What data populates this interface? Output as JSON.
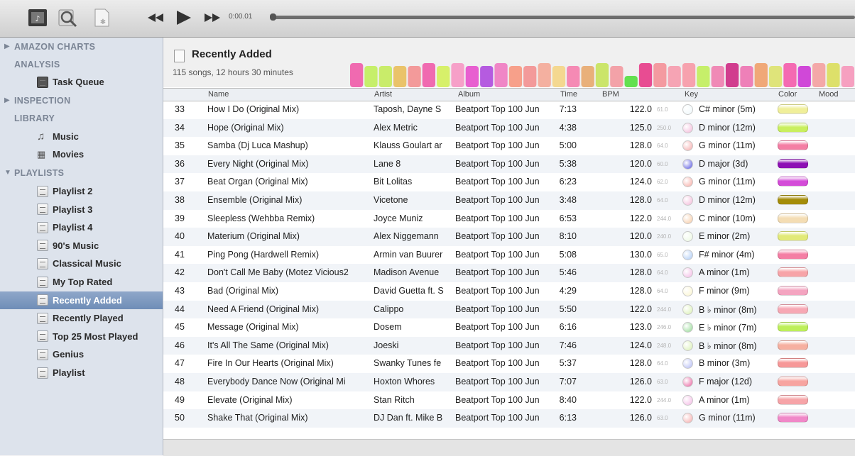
{
  "player": {
    "time": "0:00.01",
    "progress": 0.0
  },
  "sidebar": {
    "sections": [
      {
        "label": "AMAZON CHARTS",
        "collapsed": true
      },
      {
        "label": "ANALYSIS",
        "collapsed": null
      },
      {
        "label": "INSPECTION",
        "collapsed": true
      },
      {
        "label": "LIBRARY",
        "collapsed": null
      },
      {
        "label": "PLAYLISTS",
        "collapsed": false
      }
    ],
    "analysis_items": [
      "Task Queue"
    ],
    "library_items": [
      "Music",
      "Movies"
    ],
    "playlist_items": [
      "Playlist 2",
      "Playlist 3",
      "Playlist 4",
      "90's Music",
      "Classical Music",
      "My Top Rated",
      "Recently Added",
      "Recently Played",
      "Top 25 Most Played",
      "Genius",
      "Playlist"
    ],
    "selected": "Recently Added"
  },
  "playlist": {
    "title": "Recently Added",
    "subtitle": "115 songs, 12 hours 30 minutes",
    "strip_colors": [
      "#f06ab0",
      "#c6ef6a",
      "#c9ec6a",
      "#eac36a",
      "#f39a9a",
      "#f06ab0",
      "#d7f06a",
      "#f6a0c8",
      "#e85fd0",
      "#b55be0",
      "#f086c6",
      "#f7a08a",
      "#f39a9a",
      "#f4b0a0",
      "#f4d890",
      "#f58ab4",
      "#e9b07a",
      "#cbe56a",
      "#f3a2a8",
      "#63e050",
      "#e84c92",
      "#f49aa0",
      "#f6a4b4",
      "#f7a2ae",
      "#c6ef6a",
      "#f08ab6",
      "#d13d8e",
      "#ee80b8",
      "#f0a878",
      "#dfe47a",
      "#f46ab2",
      "#d048d8",
      "#f4a8a8",
      "#dde06a",
      "#f6a0c0"
    ],
    "columns": [
      "Name",
      "Artist",
      "Album",
      "Time",
      "BPM",
      "Key",
      "Color",
      "Mood"
    ],
    "rows": [
      {
        "num": "33",
        "name": "How I Do (Original Mix)",
        "artist": "Taposh, Dayne S",
        "album": "Beatport Top 100 Jun",
        "time": "7:13",
        "bpm": "122.0",
        "sm": "61.0",
        "key": "C# minor (5m)",
        "dot": "#eef8fb",
        "color": "#f0ef9a"
      },
      {
        "num": "34",
        "name": "Hope (Original Mix)",
        "artist": "Alex Metric",
        "album": "Beatport Top 100 Jun",
        "time": "4:38",
        "bpm": "125.0",
        "sm": "250.0",
        "key": "D minor (12m)",
        "dot": "#f3b6d8",
        "color": "#c9ef5e"
      },
      {
        "num": "35",
        "name": "Samba (Dj Luca Mashup)",
        "artist": "Klauss Goulart ar",
        "album": "Beatport Top 100 Jun",
        "time": "5:00",
        "bpm": "128.0",
        "sm": "64.0",
        "key": "G minor (11m)",
        "dot": "#f5a6a6",
        "color": "#f47ea4"
      },
      {
        "num": "36",
        "name": "Every Night (Original Mix)",
        "artist": "Lane 8",
        "album": "Beatport Top 100 Jun",
        "time": "5:38",
        "bpm": "120.0",
        "sm": "60.0",
        "key": "D major (3d)",
        "dot": "#5050e0",
        "color": "#8d10b4"
      },
      {
        "num": "37",
        "name": "Beat Organ (Original Mix)",
        "artist": "Bit Lolitas",
        "album": "Beatport Top 100 Jun",
        "time": "6:23",
        "bpm": "124.0",
        "sm": "62.0",
        "key": "G minor (11m)",
        "dot": "#f7a8a0",
        "color": "#d44cd8"
      },
      {
        "num": "38",
        "name": "Ensemble (Original Mix)",
        "artist": "Vicetone",
        "album": "Beatport Top 100 Jun",
        "time": "3:48",
        "bpm": "128.0",
        "sm": "64.0",
        "key": "D minor (12m)",
        "dot": "#f3b6d8",
        "color": "#a48c08"
      },
      {
        "num": "39",
        "name": "Sleepless (Wehbba Remix)",
        "artist": "Joyce Muniz",
        "album": "Beatport Top 100 Jun",
        "time": "6:53",
        "bpm": "122.0",
        "sm": "244.0",
        "key": "C minor (10m)",
        "dot": "#f6c8a0",
        "color": "#f4ddb4"
      },
      {
        "num": "40",
        "name": "Materium (Original Mix)",
        "artist": "Alex Niggemann",
        "album": "Beatport Top 100 Jun",
        "time": "8:10",
        "bpm": "120.0",
        "sm": "240.0",
        "key": "E minor (2m)",
        "dot": "#eaf8e0",
        "color": "#e2ea78"
      },
      {
        "num": "41",
        "name": "Ping Pong (Hardwell Remix)",
        "artist": "Armin van Buurer",
        "album": "Beatport Top 100 Jun",
        "time": "5:08",
        "bpm": "130.0",
        "sm": "65.0",
        "key": "F# minor (4m)",
        "dot": "#a8c8f4",
        "color": "#f47ea4"
      },
      {
        "num": "42",
        "name": "Don't Call Me Baby (Motez Vicious2",
        "artist": "Madison Avenue",
        "album": "Beatport Top 100 Jun",
        "time": "5:46",
        "bpm": "128.0",
        "sm": "64.0",
        "key": "A minor (1m)",
        "dot": "#f3b6e4",
        "color": "#f7a4a8"
      },
      {
        "num": "43",
        "name": "Bad (Original Mix)",
        "artist": "David Guetta ft. S",
        "album": "Beatport Top 100 Jun",
        "time": "4:29",
        "bpm": "128.0",
        "sm": "64.0",
        "key": "F minor (9m)",
        "dot": "#fbf5cc",
        "color": "#f4a4c0"
      },
      {
        "num": "44",
        "name": "Need A Friend (Original Mix)",
        "artist": "Calippo",
        "album": "Beatport Top 100 Jun",
        "time": "5:50",
        "bpm": "122.0",
        "sm": "244.0",
        "key": "B ♭ minor (8m)",
        "dot": "#d8f0b0",
        "color": "#f7a8b4"
      },
      {
        "num": "45",
        "name": "Message (Original Mix)",
        "artist": "Dosem",
        "album": "Beatport Top 100 Jun",
        "time": "6:16",
        "bpm": "123.0",
        "sm": "246.0",
        "key": "E ♭ minor (7m)",
        "dot": "#90d890",
        "color": "#bdef5a"
      },
      {
        "num": "46",
        "name": "It's All The Same (Original Mix)",
        "artist": "Joeski",
        "album": "Beatport Top 100 Jun",
        "time": "7:46",
        "bpm": "124.0",
        "sm": "248.0",
        "key": "B ♭ minor (8m)",
        "dot": "#d8f0b0",
        "color": "#f6b0a0"
      },
      {
        "num": "47",
        "name": "Fire In Our Hearts (Original Mix)",
        "artist": "Swanky Tunes fe",
        "album": "Beatport Top 100 Jun",
        "time": "5:37",
        "bpm": "128.0",
        "sm": "64.0",
        "key": "B minor (3m)",
        "dot": "#b0b8f4",
        "color": "#f79898"
      },
      {
        "num": "48",
        "name": "Everybody Dance Now (Original Mi",
        "artist": "Hoxton Whores",
        "album": "Beatport Top 100 Jun",
        "time": "7:07",
        "bpm": "126.0",
        "sm": "63.0",
        "key": "F major (12d)",
        "dot": "#e85a9c",
        "color": "#f7a4a0"
      },
      {
        "num": "49",
        "name": "Elevate (Original Mix)",
        "artist": "Stan Ritch",
        "album": "Beatport Top 100 Jun",
        "time": "8:40",
        "bpm": "122.0",
        "sm": "244.0",
        "key": "A minor (1m)",
        "dot": "#f3b6e4",
        "color": "#f6a4a8"
      },
      {
        "num": "50",
        "name": "Shake That (Original Mix)",
        "artist": "DJ Dan ft. Mike B",
        "album": "Beatport Top 100 Jun",
        "time": "6:13",
        "bpm": "126.0",
        "sm": "63.0",
        "key": "G minor (11m)",
        "dot": "#f5a6a6",
        "color": "#f088c8"
      }
    ]
  },
  "colors": {
    "selection": "#7591bc",
    "sidebar_bg": "#dde3ec",
    "header_text": "#7b8595"
  }
}
